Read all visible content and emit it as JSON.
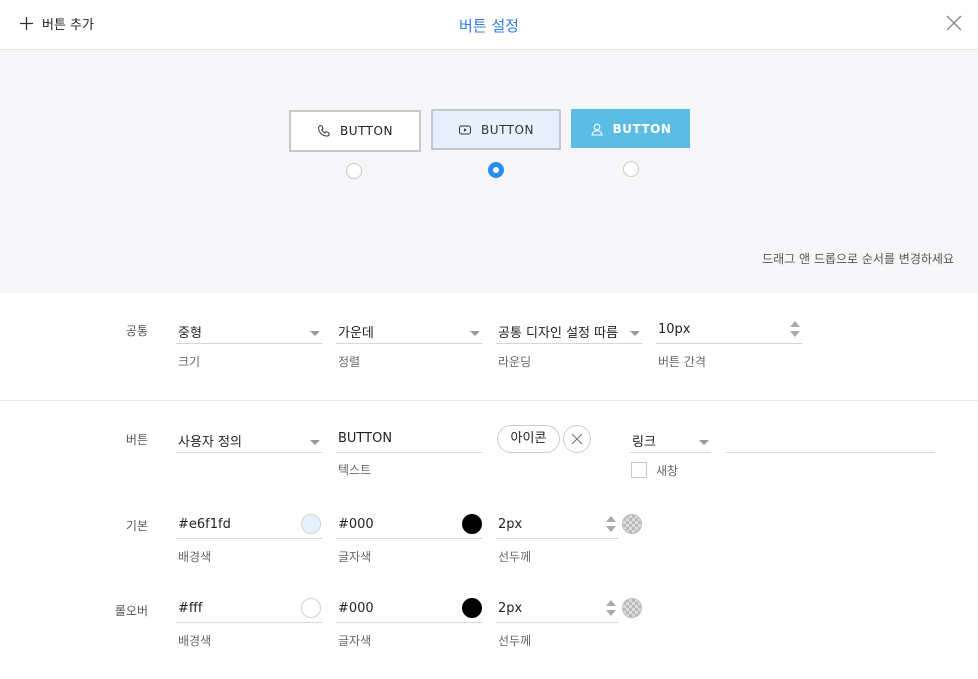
{
  "header": {
    "add_label": "버튼 추가",
    "title": "버튼 설정"
  },
  "preview": {
    "buttons": [
      {
        "label": "BUTTON",
        "icon": "phone-icon",
        "selected": false
      },
      {
        "label": "BUTTON",
        "icon": "video-play-icon",
        "selected": true
      },
      {
        "label": "BUTTON",
        "icon": "user-icon",
        "selected": false
      }
    ],
    "hint": "드래그 앤 드롭으로 순서를 변경하세요"
  },
  "common": {
    "label": "공통",
    "size": {
      "value": "중형",
      "caption": "크기"
    },
    "align": {
      "value": "가운데",
      "caption": "정렬"
    },
    "rounding": {
      "value": "공통 디자인 설정 따름",
      "caption": "라운딩"
    },
    "gap": {
      "value": "10px",
      "caption": "버튼 간격"
    }
  },
  "button": {
    "label": "버튼",
    "style": {
      "value": "사용자 정의"
    },
    "text": {
      "value": "BUTTON",
      "caption": "텍스트"
    },
    "icon_label": "아이콘",
    "link": {
      "value": "링크"
    },
    "link_url": "",
    "new_window_label": "새창",
    "new_window_checked": false
  },
  "default": {
    "label": "기본",
    "bg": {
      "value": "#e6f1fd",
      "caption": "배경색"
    },
    "text_color": {
      "value": "#000",
      "caption": "글자색"
    },
    "border": {
      "value": "2px",
      "caption": "선두께"
    }
  },
  "hover": {
    "label": "롤오버",
    "bg": {
      "value": "#fff",
      "caption": "배경색"
    },
    "text_color": {
      "value": "#000",
      "caption": "글자색"
    },
    "border": {
      "value": "2px",
      "caption": "선두께"
    }
  },
  "colors": {
    "accent": "#2f7de1",
    "radio_checked": "#2a8ee8",
    "preview_bg": "#f6f6f8",
    "button3_bg": "#5bbde3"
  }
}
